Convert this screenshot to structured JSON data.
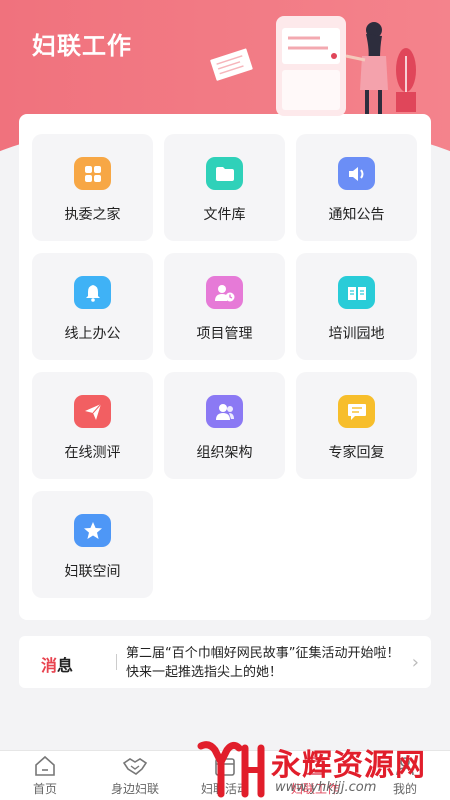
{
  "header": {
    "title": "妇联工作"
  },
  "grid": [
    {
      "label": "执委之家",
      "icon": "grid-icon",
      "color": "#f7a745"
    },
    {
      "label": "文件库",
      "icon": "folder-icon",
      "color": "#2fd1b9"
    },
    {
      "label": "通知公告",
      "icon": "speaker-icon",
      "color": "#6b8ef6"
    },
    {
      "label": "线上办公",
      "icon": "bell-icon",
      "color": "#3fb2f6"
    },
    {
      "label": "项目管理",
      "icon": "user-clock-icon",
      "color": "#e67ad7"
    },
    {
      "label": "培训园地",
      "icon": "book-icon",
      "color": "#29ccd8"
    },
    {
      "label": "在线测评",
      "icon": "paper-plane-icon",
      "color": "#f25f62"
    },
    {
      "label": "组织架构",
      "icon": "users-icon",
      "color": "#8b79f4"
    },
    {
      "label": "专家回复",
      "icon": "message-icon",
      "color": "#f7be2b"
    },
    {
      "label": "妇联空间",
      "icon": "star-icon",
      "color": "#4e97f6"
    }
  ],
  "news": {
    "tag_part1": "消",
    "tag_part2": "息",
    "text": "第二届“百个巾帼好网民故事”征集活动开始啦！快来一起推选指尖上的她！"
  },
  "tabs": [
    {
      "label": "首页",
      "icon": "home-icon"
    },
    {
      "label": "身边妇联",
      "icon": "handshake-icon"
    },
    {
      "label": "妇联活动",
      "icon": "calendar-icon"
    },
    {
      "label": "妇联工作",
      "icon": "briefcase-icon"
    },
    {
      "label": "我的",
      "icon": "profile-icon"
    }
  ],
  "watermark": {
    "name": "永辉资源网",
    "url": "www.yhkjjj.com"
  }
}
